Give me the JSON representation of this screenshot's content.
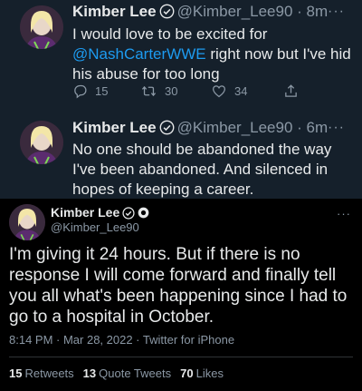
{
  "colors": {
    "dim_background": "#15202b",
    "black_background": "#000000",
    "link_blue": "#1d9bf0",
    "secondary_text": "#8b98a5",
    "verified_badge": "#e7e9ea"
  },
  "tweets": [
    {
      "name": "Kimber Lee",
      "handle": "@Kimber_Lee90",
      "time": "· 8m",
      "text_before": "I would love to be excited for",
      "mention": "@NashCarterWWE",
      "text_after": " right now but I've hid his abuse for too long",
      "replies": "15",
      "retweets": "30",
      "likes": "34"
    },
    {
      "name": "Kimber Lee",
      "handle": "@Kimber_Lee90",
      "time": "· 6m",
      "text": "No one should be abandoned the way I've been abandoned. And silenced in hopes of keeping a career."
    }
  ],
  "main_tweet": {
    "name": "Kimber Lee",
    "handle": "@Kimber_Lee90",
    "text": "I'm giving it 24 hours. But if there is no response I will come forward and finally tell you all what's been happening since I had to go to a hospital in October.",
    "meta": "8:14 PM · Mar 28, 2022 · Twitter for iPhone",
    "retweets_count": "15",
    "retweets_label": "Retweets",
    "quotes_count": "13",
    "quotes_label": "Quote Tweets",
    "likes_count": "70",
    "likes_label": "Likes"
  },
  "icons": {
    "more": "more-horizontal-icon",
    "verified": "verified-badge-icon",
    "reply": "reply-icon",
    "retweet": "retweet-icon",
    "like": "heart-icon",
    "share": "share-icon"
  },
  "more_glyph": "···"
}
